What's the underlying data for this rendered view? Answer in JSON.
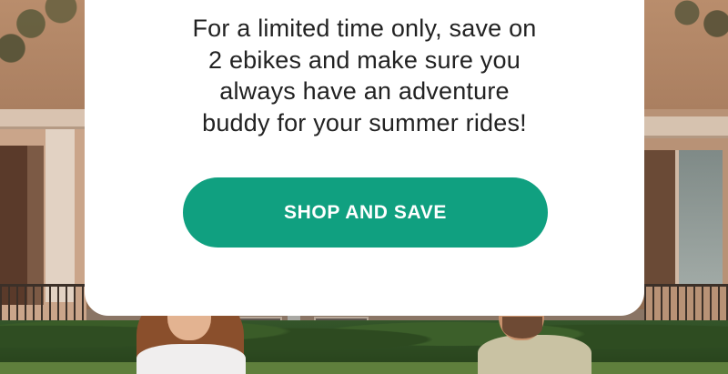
{
  "promo": {
    "lines": [
      "For a limited time only, save on",
      "2 ebikes and make sure you",
      "always have an adventure",
      "buddy for your summer rides!"
    ],
    "cta_label": "SHOP AND SAVE"
  },
  "colors": {
    "cta_background": "#10a080",
    "cta_text": "#ffffff",
    "card_background": "#ffffff",
    "body_text": "#222222"
  }
}
